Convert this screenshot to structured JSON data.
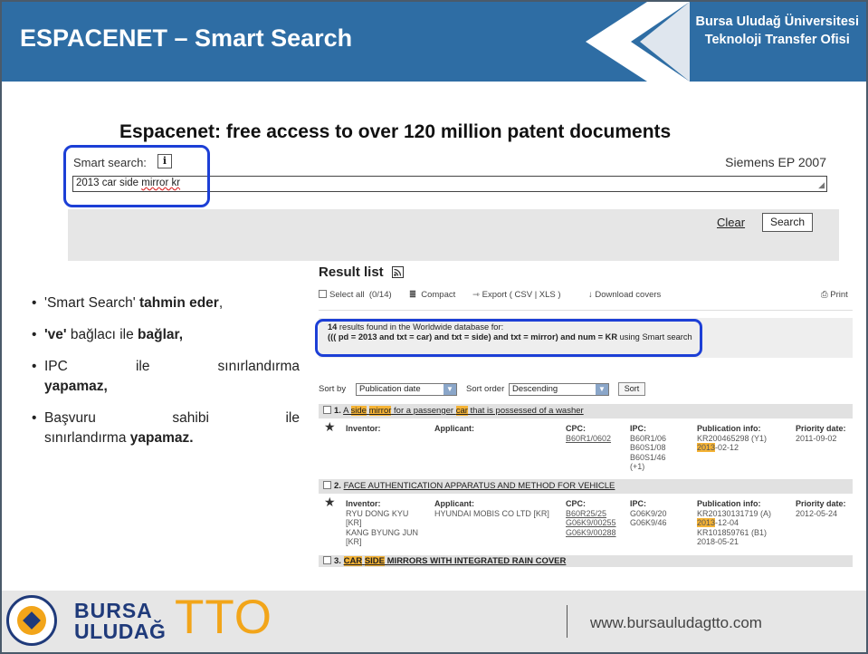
{
  "header": {
    "title": "ESPACENET – Smart Search",
    "org_line1": "Bursa Uludağ Üniversitesi",
    "org_line2": "Teknoloji Transfer Ofisi"
  },
  "espacenet": {
    "title": "Espacenet: free access to over 120 million patent documents",
    "smart_search_label": "Smart search:",
    "info_icon": "i",
    "example": "Siemens EP 2007",
    "query_plain": "2013 car side ",
    "query_typo": "mirror kr",
    "clear_label": "Clear",
    "search_label": "Search"
  },
  "bullets": [
    {
      "pre": "'Smart Search' ",
      "bold": "tahmin eder",
      "post": ","
    },
    {
      "bold_first": "'ve'",
      "mid": " bağlacı ile ",
      "bold": "bağlar,"
    },
    {
      "w1": "IPC",
      "w2": "ile",
      "w3": "sınırlandırma",
      "bold": "yapamaz,"
    },
    {
      "w1": "Başvuru",
      "w2": "sahibi",
      "w3": "ile",
      "line2_pre": "sınırlandırma ",
      "bold": "yapamaz."
    }
  ],
  "result_list": {
    "title": "Result list",
    "toolbar": {
      "select_all": "Select all",
      "count": "(0/14)",
      "compact": "Compact",
      "export": "Export",
      "export_formats": "( CSV | XLS )",
      "download": "Download covers",
      "print": "Print"
    },
    "info_count": "14",
    "info_line1_rest": " results found in the Worldwide database for:",
    "info_line2": "((( pd = 2013 and txt = car) and txt = side) and txt = mirror) and num = KR",
    "info_line2_tail": " using Smart search",
    "sort_by_label": "Sort by",
    "sort_by_value": "Publication date",
    "sort_order_label": "Sort order",
    "sort_order_value": "Descending",
    "sort_button": "Sort",
    "results": [
      {
        "num": "1.",
        "t1": "A ",
        "h1": "side",
        "t2": " ",
        "h2": "mirror",
        "t3": " for a passenger ",
        "h3": "car",
        "t4": " that is possessed of a washer",
        "inventor_label": "Inventor:",
        "applicant_label": "Applicant:",
        "cpc_label": "CPC:",
        "cpc": "B60R1/0602",
        "ipc_label": "IPC:",
        "ipc": [
          "B60R1/06",
          "B60S1/08",
          "B60S1/46",
          "(+1)"
        ],
        "pub_label": "Publication info:",
        "pub1": "KR200465298 (Y1)",
        "pub_hl": "2013",
        "pub_rest": "-02-12",
        "prio_label": "Priority date:",
        "prio": "2011-09-02"
      },
      {
        "num": "2.",
        "title": "FACE AUTHENTICATION APPARATUS AND METHOD FOR VEHICLE",
        "inventor_label": "Inventor:",
        "inventors": [
          "RYU DONG KYU",
          "[KR]",
          "KANG BYUNG JUN",
          "[KR]"
        ],
        "applicant_label": "Applicant:",
        "applicant": "HYUNDAI MOBIS CO LTD  [KR]",
        "cpc_label": "CPC:",
        "cpc": [
          "B60R25/25",
          "G06K9/00255",
          "G06K9/00288"
        ],
        "ipc_label": "IPC:",
        "ipc": [
          "G06K9/20",
          "G06K9/46"
        ],
        "pub_label": "Publication info:",
        "pub1": "KR20130131719 (A)",
        "pub_hl": "2013",
        "pub_rest": "-12-04",
        "pub2": "KR101859761 (B1)",
        "pub3": "2018-05-21",
        "prio_label": "Priority date:",
        "prio": "2012-05-24"
      },
      {
        "num": "3.",
        "h1": "CAR",
        "h2": "SIDE",
        "t": " MIRRORS WITH INTEGRATED RAIN COVER"
      }
    ]
  },
  "footer": {
    "bursa": "BURSA",
    "uludag": "ULUDAĞ",
    "tto": "TTO",
    "url": "www.bursauludagtto.com"
  },
  "colors": {
    "header_bg": "#2e6da4",
    "highlight_box": "#1c3fd6",
    "search_highlight": "#f5b335",
    "logo_orange": "#f2a51a",
    "logo_navy": "#1f3a7a"
  }
}
